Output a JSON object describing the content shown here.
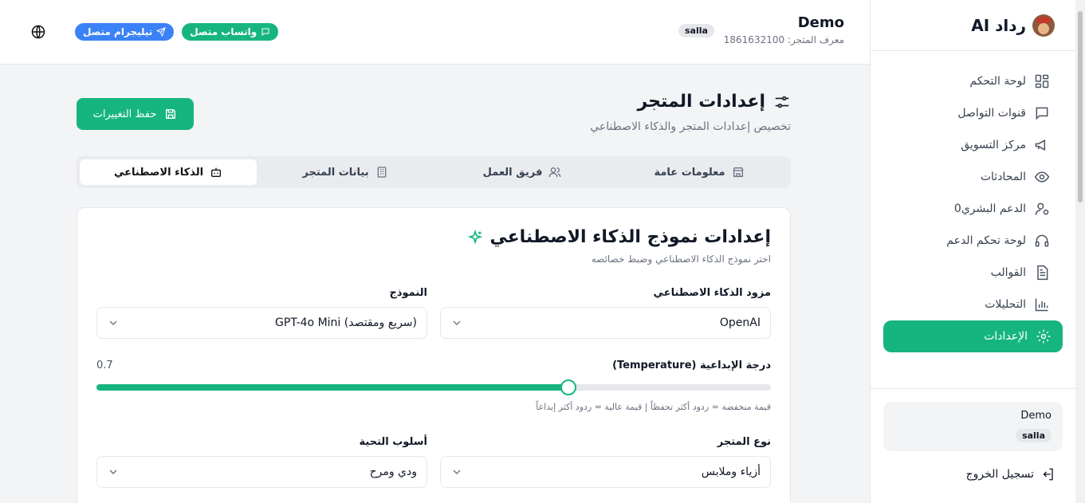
{
  "header": {
    "store_name": "Demo",
    "store_id": "معرف المتجر: 1861632100",
    "platform": "salla",
    "whatsapp": "واتساب متصل",
    "telegram": "تيليجرام متصل"
  },
  "sidebar": {
    "brand": "رداد AI",
    "items": [
      {
        "label": "لوحة التحكم",
        "icon": "dashboard-icon"
      },
      {
        "label": "قنوات التواصل",
        "icon": "chat-icon"
      },
      {
        "label": "مركز التسويق",
        "icon": "megaphone-icon"
      },
      {
        "label": "المحادثات",
        "icon": "eye-icon"
      },
      {
        "label": "الدعم البشري0",
        "icon": "user-gear-icon"
      },
      {
        "label": "لوحة تحكم الدعم",
        "icon": "headphones-icon"
      },
      {
        "label": "القوالب",
        "icon": "document-icon"
      },
      {
        "label": "التحليلات",
        "icon": "chart-icon"
      },
      {
        "label": "الإعدادات",
        "icon": "gear-icon"
      }
    ],
    "store_card": {
      "name": "Demo",
      "platform": "salla"
    },
    "logout": "تسجيل الخروج"
  },
  "page": {
    "title": "إعدادات المتجر",
    "subtitle": "تخصيص إعدادات المتجر والذكاء الاصطناعي",
    "save": "حفظ التغييرات",
    "tabs": [
      "معلومات عامة",
      "فريق العمل",
      "بيانات المتجر",
      "الذكاء الاصطناعي"
    ]
  },
  "ai": {
    "title": "إعدادات نموذج الذكاء الاصطناعي",
    "subtitle": "اختر نموذج الذكاء الاصطناعي وضبط خصائصه",
    "provider_label": "مزود الذكاء الاصطناعي",
    "provider": "OpenAI",
    "model_label": "النموذج",
    "model": "GPT-4o Mini (سريع ومقتصد)",
    "temperature_label": "درجة الإبداعية (Temperature)",
    "temperature_value": "0.7",
    "temperature_fraction": 0.7,
    "temperature_hint": "قيمة منخفضة = ردود أكثر تحفظاً | قيمة عالية = ردود أكثر إبداعاً",
    "store_type_label": "نوع المتجر",
    "store_type": "أزياء وملابس",
    "greeting_label": "أسلوب التحية",
    "greeting": "ودي ومرح"
  },
  "colors": {
    "accent": "#16b57f",
    "telegram": "#3b82f6"
  }
}
